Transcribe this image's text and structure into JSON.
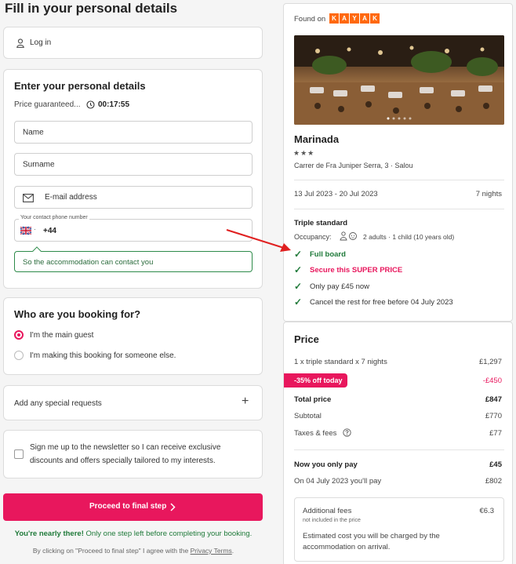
{
  "page": {
    "title": "Fill in your personal details"
  },
  "login": {
    "label": "Log in"
  },
  "personal": {
    "heading": "Enter your personal details",
    "price_guaranteed": "Price guaranteed...",
    "timer": "00:17:55",
    "name_placeholder": "Name",
    "surname_placeholder": "Surname",
    "email_placeholder": "E-mail address",
    "phone_label": "Your contact phone number",
    "phone_code": "+44",
    "phone_hint": "So the accommodation can contact you"
  },
  "booking_for": {
    "heading": "Who are you booking for?",
    "option_main": "I'm the main guest",
    "option_other": "I'm making this booking for someone else."
  },
  "special_requests": {
    "label": "Add any special requests",
    "plus": "+"
  },
  "newsletter": {
    "line1": "Sign me up to the newsletter so I can receive exclusive",
    "line2": "discounts and offers specially tailored to my interests."
  },
  "cta": {
    "label": "Proceed to final step",
    "nearly_bold": "You're nearly there!",
    "nearly_rest": "Only one step left before completing your booking.",
    "terms_prefix": "By clicking on \"Proceed to final step\" I agree with the",
    "terms_link": "Privacy Terms",
    "terms_suffix": "."
  },
  "hotel": {
    "found_on": "Found on",
    "brand_letters": [
      "K",
      "A",
      "Y",
      "A",
      "K"
    ],
    "name": "Marinada",
    "stars": "★★★",
    "address": "Carrer de Fra Juniper Serra, 3 · Salou",
    "dates": "13 Jul 2023 - 20 Jul 2023",
    "nights": "7 nights",
    "room": "Triple standard",
    "occupancy_label": "Occupancy:",
    "occupancy_value": "2 adults · 1 child (10 years old)",
    "features": [
      {
        "text": "Full board",
        "style": "green"
      },
      {
        "text": "Secure this SUPER PRICE",
        "style": "pink"
      },
      {
        "text": "Only pay £45 now",
        "style": "normal"
      },
      {
        "text": "Cancel the rest for free before 04 July 2023",
        "style": "normal"
      }
    ]
  },
  "price": {
    "heading": "Price",
    "room_line": "1 x triple standard x 7 nights",
    "room_value": "£1,297",
    "discount_badge": "-35% off today",
    "discount_value": "-£450",
    "total_label": "Total price",
    "total_value": "£847",
    "subtotal_label": "Subtotal",
    "subtotal_value": "£770",
    "taxes_label": "Taxes & fees",
    "taxes_value": "£77",
    "now_label": "Now you only pay",
    "now_value": "£45",
    "later_label": "On 04 July 2023 you'll pay",
    "later_value": "£802",
    "fees_title": "Additional fees",
    "fees_sub": "not included in the price",
    "fees_value": "€6.3",
    "fees_note_1": "Estimated cost you will be charged by the",
    "fees_note_2": "accommodation on arrival."
  },
  "colors": {
    "accent": "#e8175d",
    "green": "#1f7a3a",
    "kayak": "#ff690f",
    "arrow": "#e02020"
  }
}
